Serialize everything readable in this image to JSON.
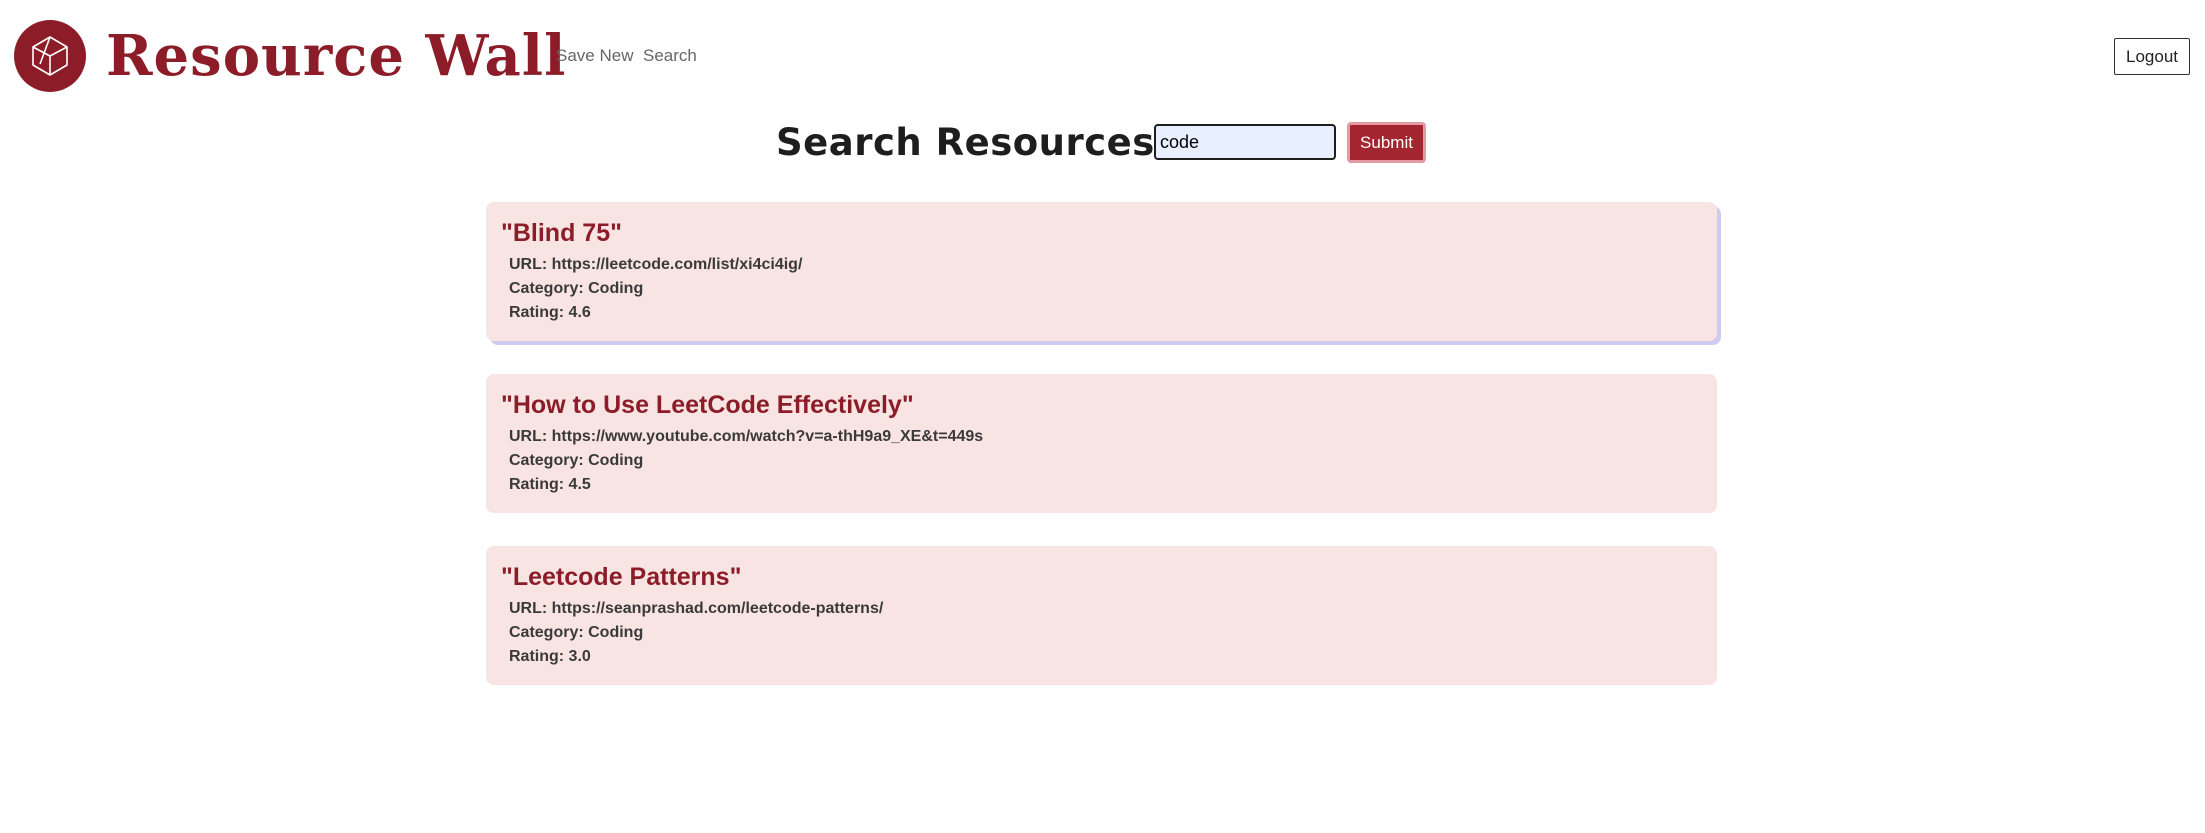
{
  "header": {
    "brand": "Resource Wall",
    "nav": {
      "save_new": "Save New",
      "search": "Search"
    },
    "logout_label": "Logout",
    "colors": {
      "brand": "#8c1d28"
    }
  },
  "search": {
    "title": "Search Resources:",
    "input_value": "code",
    "submit_label": "Submit"
  },
  "results": [
    {
      "title": "\"Blind 75\"",
      "url": "URL: https://leetcode.com/list/xi4ci4ig/",
      "category": "Category: Coding",
      "rating": "Rating: 4.6"
    },
    {
      "title": "\"How to Use LeetCode Effectively\"",
      "url": "URL: https://www.youtube.com/watch?v=a-thH9a9_XE&t=449s",
      "category": "Category: Coding",
      "rating": "Rating: 4.5"
    },
    {
      "title": "\"Leetcode Patterns\"",
      "url": "URL: https://seanprashad.com/leetcode-patterns/",
      "category": "Category: Coding",
      "rating": "Rating: 3.0"
    }
  ]
}
